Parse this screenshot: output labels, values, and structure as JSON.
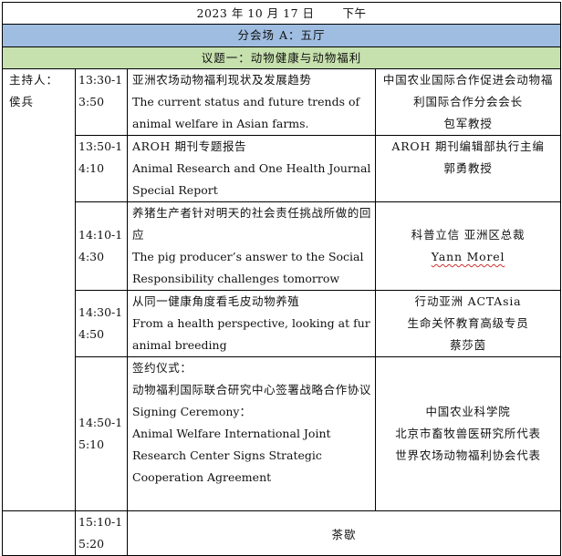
{
  "header": {
    "date": "2023 年 10 月 17 日",
    "period": "下午"
  },
  "session": {
    "title": "分会场 A：五厅"
  },
  "topic": {
    "title": "议题一：动物健康与动物福利"
  },
  "host": {
    "label": "主持人：",
    "name": "侯兵"
  },
  "talks": [
    {
      "time": "13:30-13:50",
      "title_zh": "亚洲农场动物福利现状及发展趋势",
      "title_en": "The current status and future trends of animal welfare in Asian farms.",
      "speaker_lines": [
        "中国农业国际合作促进会动物福利国际合作分会会长",
        "包军教授"
      ]
    },
    {
      "time": "13:50-14:10",
      "title_zh": "AROH 期刊专题报告",
      "title_en": "Animal Research and One Health Journal Special Report",
      "speaker_lines": [
        "AROH 期刊编辑部执行主编",
        "郭勇教授"
      ]
    },
    {
      "time": "14:10-14:30",
      "title_zh": "养猪生产者针对明天的社会责任挑战所做的回应",
      "title_en": "The pig producer’s answer to the Social Responsibility challenges tomorrow",
      "speaker_lines": [
        "科普立信 亚洲区总裁",
        "Yann Morel"
      ]
    },
    {
      "time": "14:30-14:50",
      "title_zh": "从同一健康角度看毛皮动物养殖",
      "title_en": "From a health perspective, looking at fur animal breeding",
      "speaker_lines": [
        "行动亚洲 ACTAsia",
        "生命关怀教育高级专员",
        "蔡莎茵"
      ]
    },
    {
      "time": "14:50-15:10",
      "title_zh_lines": [
        "签约仪式：",
        "动物福利国际联合研究中心签署战略合作协议"
      ],
      "title_en_lines": [
        "Signing Ceremony：",
        "Animal Welfare International Joint Research Center Signs Strategic Cooperation Agreement"
      ],
      "speaker_lines": [
        "中国农业科学院",
        "北京市畜牧兽医研究所代表",
        "世界农场动物福利协会代表"
      ]
    }
  ],
  "tea_break": {
    "time": "15:10-15:20",
    "label": "茶歇"
  }
}
